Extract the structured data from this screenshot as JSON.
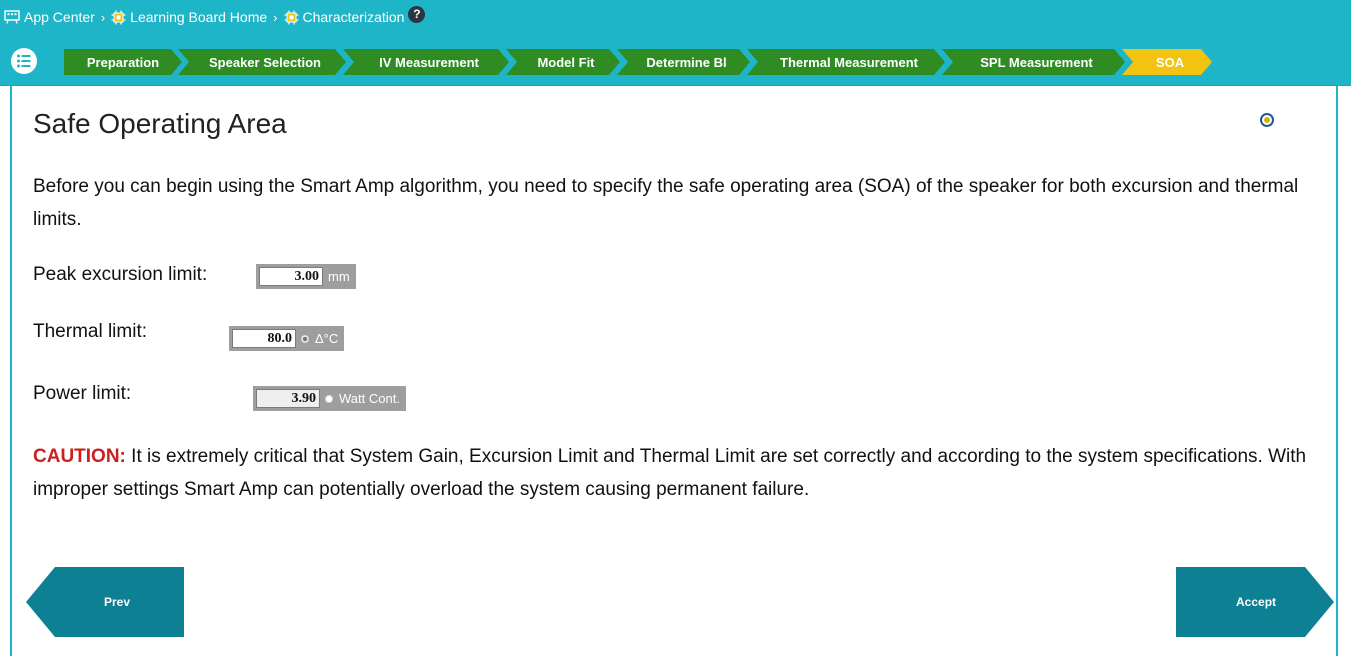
{
  "breadcrumb": {
    "items": [
      {
        "label": "App Center",
        "icon": "board-icon"
      },
      {
        "label": "Learning Board Home",
        "icon": "chip-icon"
      },
      {
        "label": "Characterization",
        "icon": "chip-icon"
      }
    ],
    "help": "?"
  },
  "steps": [
    {
      "label": "Preparation",
      "active": false
    },
    {
      "label": "Speaker Selection",
      "active": false
    },
    {
      "label": "IV Measurement",
      "active": false
    },
    {
      "label": "Model Fit",
      "active": false
    },
    {
      "label": "Determine Bl",
      "active": false
    },
    {
      "label": "Thermal Measurement",
      "active": false
    },
    {
      "label": "SPL Measurement",
      "active": false
    },
    {
      "label": "SOA",
      "active": true
    }
  ],
  "colors": {
    "teal": "#1fb5c8",
    "step_green": "#2e8c23",
    "step_active": "#f2c311",
    "nav_teal": "#0e8093",
    "caution_red": "#cc1f1f"
  },
  "page": {
    "title": "Safe Operating Area",
    "intro": "Before you can begin using the Smart Amp algorithm, you need to specify the safe operating area (SOA) of the speaker for both excursion and thermal limits."
  },
  "fields": {
    "excursion": {
      "label": "Peak excursion limit:",
      "value": "3.00",
      "unit": "mm"
    },
    "thermal": {
      "label": "Thermal limit:",
      "value": "80.0",
      "unit": "Δ°C",
      "selected": true
    },
    "power": {
      "label": "Power limit:",
      "value": "3.90",
      "unit": "Watt Cont.",
      "selected": false
    }
  },
  "caution": {
    "word": "CAUTION:",
    "text": " It is extremely critical that System Gain, Excursion Limit and Thermal Limit are set correctly and according to the system specifications. With improper settings Smart Amp can potentially overload the system causing permanent failure."
  },
  "nav": {
    "prev_label": "Prev",
    "accept_label": "Accept"
  }
}
